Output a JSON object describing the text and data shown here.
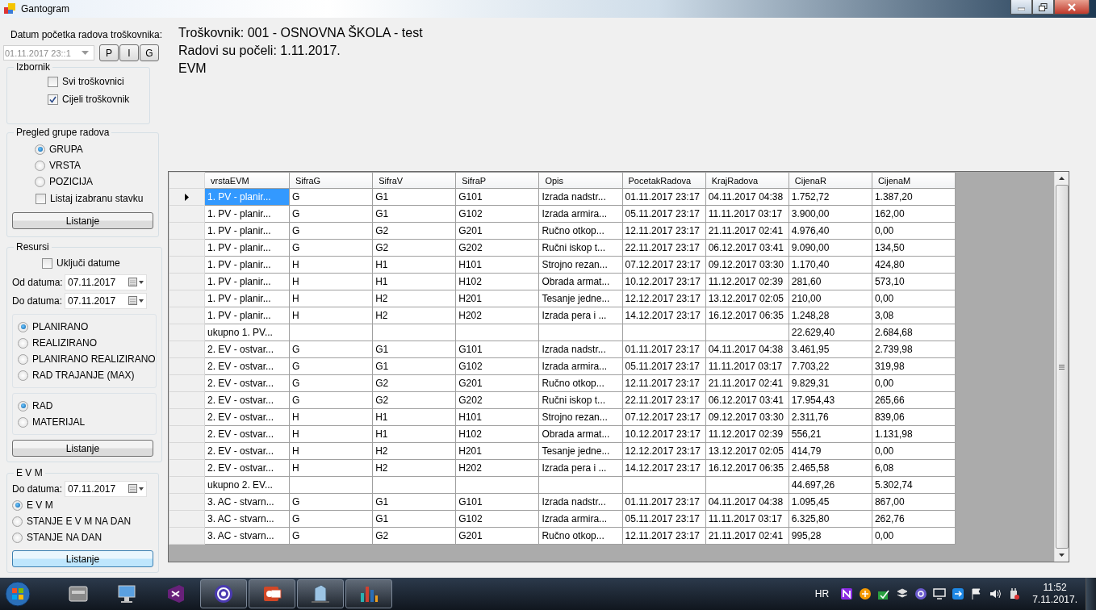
{
  "window": {
    "title": "Gantogram"
  },
  "sidebar": {
    "start_date": {
      "label": "Datum početka radova troškovnika:",
      "value": "01.11.2017 23::1",
      "disabled": true,
      "buttons": [
        "P",
        "I",
        "G"
      ]
    },
    "izbornik": {
      "title": "Izbornik",
      "checkboxes": [
        {
          "label": "Svi troškovnici",
          "checked": false
        },
        {
          "label": "Cijeli troškovnik",
          "checked": true
        }
      ]
    },
    "pregled": {
      "title": "Pregled grupe radova",
      "options": [
        {
          "label": "GRUPA",
          "selected": true
        },
        {
          "label": "VRSTA",
          "selected": false
        },
        {
          "label": "POZICIJA",
          "selected": false
        }
      ],
      "checkbox": {
        "label": "Listaj izabranu stavku",
        "checked": false
      },
      "button": {
        "label": "Listanje",
        "focused": false
      }
    },
    "resursi": {
      "title": "Resursi",
      "checkbox": {
        "label": "Uključi datume",
        "checked": false
      },
      "dates": [
        {
          "label": "Od datuma:",
          "value": "07.11.2017"
        },
        {
          "label": "Do datuma:",
          "value": "07.11.2017"
        }
      ],
      "option_groups": [
        [
          {
            "label": "PLANIRANO",
            "selected": true
          },
          {
            "label": "REALIZIRANO",
            "selected": false
          },
          {
            "label": "PLANIRANO REALIZIRANO",
            "selected": false
          },
          {
            "label": "RAD TRAJANJE (MAX)",
            "selected": false
          }
        ],
        [
          {
            "label": "RAD",
            "selected": true
          },
          {
            "label": "MATERIJAL",
            "selected": false
          }
        ]
      ],
      "button": {
        "label": "Listanje",
        "focused": false
      }
    },
    "evm": {
      "title": "E V M",
      "date": {
        "label": "Do datuma:",
        "value": "07.11.2017"
      },
      "options": [
        {
          "label": "E V M",
          "selected": true
        },
        {
          "label": "STANJE  E V M   NA DAN",
          "selected": false
        },
        {
          "label": "STANJE NA DAN",
          "selected": false
        }
      ],
      "button": {
        "label": "Listanje",
        "focused": true
      }
    }
  },
  "header": {
    "lines": [
      "Troškovnik: 001 - OSNOVNA ŠKOLA - test",
      "Radovi su počeli: 1.11.2017.",
      "EVM"
    ]
  },
  "table": {
    "columns": [
      "vrstaEVM",
      "SifraG",
      "SifraV",
      "SifraP",
      "Opis",
      "PocetakRadova",
      "KrajRadova",
      "CijenaR",
      "CijenaM"
    ],
    "rows": [
      {
        "current": true,
        "cells": [
          "1. PV - planir...",
          "G",
          "G1",
          "G101",
          "Izrada nadstr...",
          "01.11.2017 23:17",
          "04.11.2017 04:38",
          "1.752,72",
          "1.387,20"
        ]
      },
      {
        "current": false,
        "cells": [
          "1. PV - planir...",
          "G",
          "G1",
          "G102",
          "Izrada armira...",
          "05.11.2017 23:17",
          "11.11.2017 03:17",
          "3.900,00",
          "162,00"
        ]
      },
      {
        "current": false,
        "cells": [
          "1. PV - planir...",
          "G",
          "G2",
          "G201",
          "Ručno otkop...",
          "12.11.2017 23:17",
          "21.11.2017 02:41",
          "4.976,40",
          "0,00"
        ]
      },
      {
        "current": false,
        "cells": [
          "1. PV - planir...",
          "G",
          "G2",
          "G202",
          "Ručni iskop t...",
          "22.11.2017 23:17",
          "06.12.2017 03:41",
          "9.090,00",
          "134,50"
        ]
      },
      {
        "current": false,
        "cells": [
          "1. PV - planir...",
          "H",
          "H1",
          "H101",
          "Strojno rezan...",
          "07.12.2017 23:17",
          "09.12.2017 03:30",
          "1.170,40",
          "424,80"
        ]
      },
      {
        "current": false,
        "cells": [
          "1. PV - planir...",
          "H",
          "H1",
          "H102",
          "Obrada armat...",
          "10.12.2017 23:17",
          "11.12.2017 02:39",
          "281,60",
          "573,10"
        ]
      },
      {
        "current": false,
        "cells": [
          "1. PV - planir...",
          "H",
          "H2",
          "H201",
          "Tesanje jedne...",
          "12.12.2017 23:17",
          "13.12.2017 02:05",
          "210,00",
          "0,00"
        ]
      },
      {
        "current": false,
        "cells": [
          "1. PV - planir...",
          "H",
          "H2",
          "H202",
          "Izrada pera i ...",
          "14.12.2017 23:17",
          "16.12.2017 06:35",
          "1.248,28",
          "3,08"
        ]
      },
      {
        "current": false,
        "cells": [
          "ukupno 1. PV...",
          "",
          "",
          "",
          "",
          "",
          "",
          "22.629,40",
          "2.684,68"
        ]
      },
      {
        "current": false,
        "cells": [
          "2. EV - ostvar...",
          "G",
          "G1",
          "G101",
          "Izrada nadstr...",
          "01.11.2017 23:17",
          "04.11.2017 04:38",
          "3.461,95",
          "2.739,98"
        ]
      },
      {
        "current": false,
        "cells": [
          "2. EV - ostvar...",
          "G",
          "G1",
          "G102",
          "Izrada armira...",
          "05.11.2017 23:17",
          "11.11.2017 03:17",
          "7.703,22",
          "319,98"
        ]
      },
      {
        "current": false,
        "cells": [
          "2. EV - ostvar...",
          "G",
          "G2",
          "G201",
          "Ručno otkop...",
          "12.11.2017 23:17",
          "21.11.2017 02:41",
          "9.829,31",
          "0,00"
        ]
      },
      {
        "current": false,
        "cells": [
          "2. EV - ostvar...",
          "G",
          "G2",
          "G202",
          "Ručni iskop t...",
          "22.11.2017 23:17",
          "06.12.2017 03:41",
          "17.954,43",
          "265,66"
        ]
      },
      {
        "current": false,
        "cells": [
          "2. EV - ostvar...",
          "H",
          "H1",
          "H101",
          "Strojno rezan...",
          "07.12.2017 23:17",
          "09.12.2017 03:30",
          "2.311,76",
          "839,06"
        ]
      },
      {
        "current": false,
        "cells": [
          "2. EV - ostvar...",
          "H",
          "H1",
          "H102",
          "Obrada armat...",
          "10.12.2017 23:17",
          "11.12.2017 02:39",
          "556,21",
          "1.131,98"
        ]
      },
      {
        "current": false,
        "cells": [
          "2. EV - ostvar...",
          "H",
          "H2",
          "H201",
          "Tesanje jedne...",
          "12.12.2017 23:17",
          "13.12.2017 02:05",
          "414,79",
          "0,00"
        ]
      },
      {
        "current": false,
        "cells": [
          "2. EV - ostvar...",
          "H",
          "H2",
          "H202",
          "Izrada pera i ...",
          "14.12.2017 23:17",
          "16.12.2017 06:35",
          "2.465,58",
          "6,08"
        ]
      },
      {
        "current": false,
        "cells": [
          "ukupno 2. EV...",
          "",
          "",
          "",
          "",
          "",
          "",
          "44.697,26",
          "5.302,74"
        ]
      },
      {
        "current": false,
        "cells": [
          "3. AC - stvarn...",
          "G",
          "G1",
          "G101",
          "Izrada nadstr...",
          "01.11.2017 23:17",
          "04.11.2017 04:38",
          "1.095,45",
          "867,00"
        ]
      },
      {
        "current": false,
        "cells": [
          "3. AC - stvarn...",
          "G",
          "G1",
          "G102",
          "Izrada armira...",
          "05.11.2017 23:17",
          "11.11.2017 03:17",
          "6.325,80",
          "262,76"
        ]
      },
      {
        "current": false,
        "cells": [
          "3. AC - stvarn...",
          "G",
          "G2",
          "G201",
          "Ručno otkop...",
          "12.11.2017 23:17",
          "21.11.2017 02:41",
          "995,28",
          "0,00"
        ]
      }
    ]
  },
  "taskbar": {
    "apps": [
      {
        "kind": "box",
        "running": false
      },
      {
        "kind": "monitor",
        "running": false
      },
      {
        "kind": "vs",
        "running": false
      },
      {
        "kind": "swirl",
        "running": true
      },
      {
        "kind": "slides",
        "running": true
      },
      {
        "kind": "building",
        "running": true
      },
      {
        "kind": "chart",
        "running": true
      }
    ],
    "language": "HR",
    "tray": [
      {
        "kind": "note"
      },
      {
        "kind": "orb"
      },
      {
        "kind": "check"
      },
      {
        "kind": "box"
      },
      {
        "kind": "swirl"
      },
      {
        "kind": "screen"
      },
      {
        "kind": "share"
      },
      {
        "kind": "flag"
      },
      {
        "kind": "speaker"
      },
      {
        "kind": "plug"
      }
    ],
    "time": "11:52",
    "date": "7.11.2017."
  }
}
